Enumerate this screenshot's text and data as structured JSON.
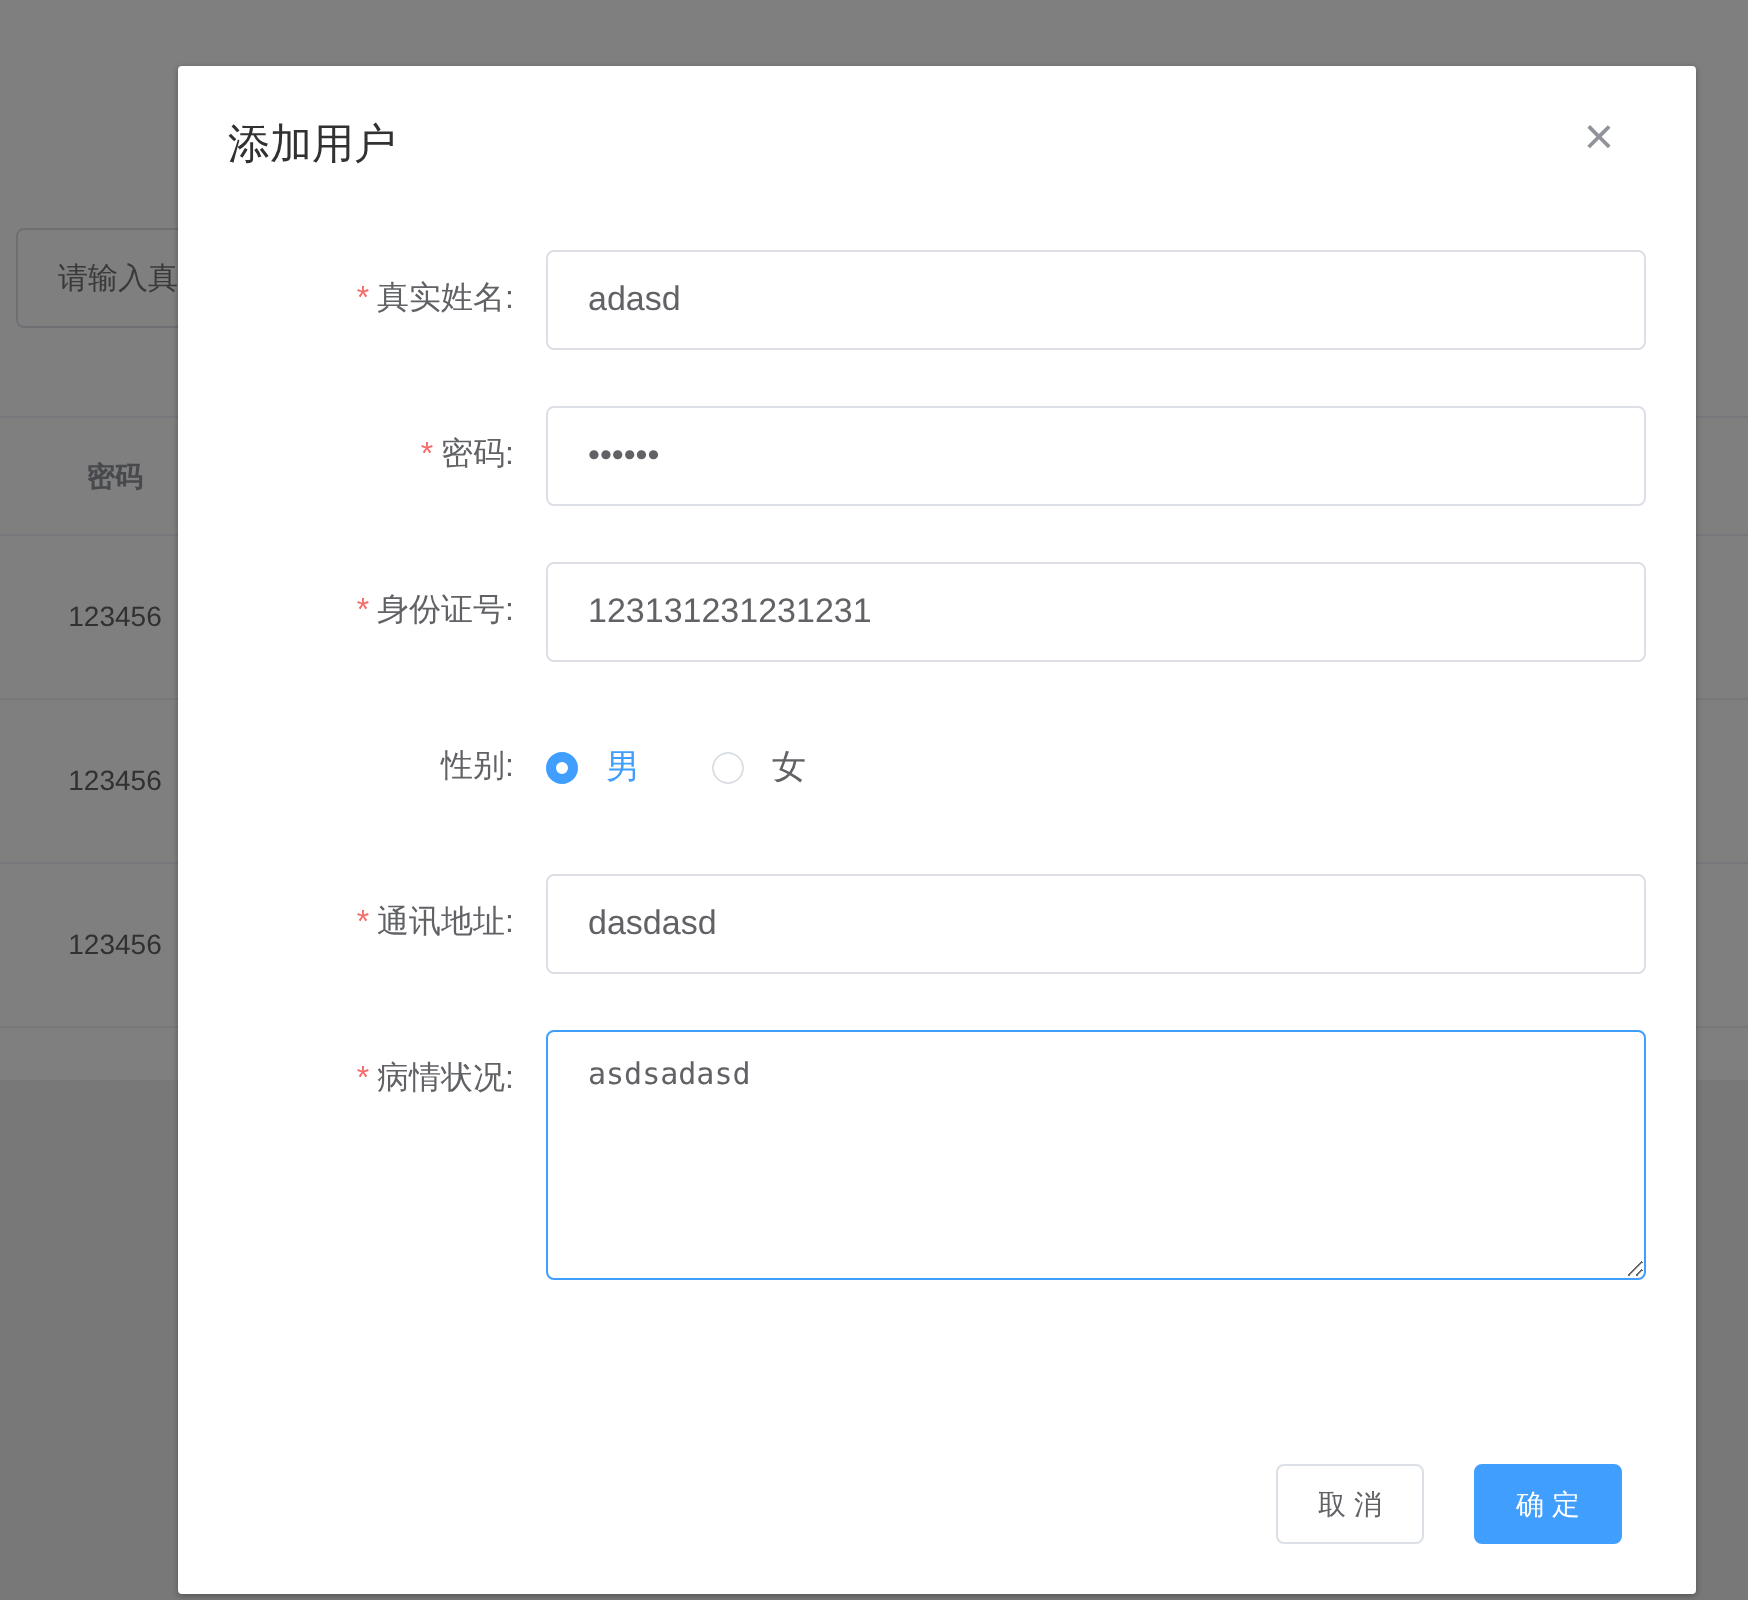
{
  "background": {
    "search": {
      "placeholder": "请输入真"
    },
    "table": {
      "columns": [
        "密码"
      ],
      "rows": [
        [
          "123456"
        ],
        [
          "123456"
        ],
        [
          "123456"
        ]
      ]
    }
  },
  "dialog": {
    "title": "添加用户",
    "close": "×",
    "required_mark": "*",
    "fields": [
      {
        "kind": "text",
        "label": "真实姓名:",
        "required": true,
        "value": "adasd",
        "focused": false
      },
      {
        "kind": "text",
        "label": "密码:",
        "required": true,
        "value": "••••••",
        "focused": false
      },
      {
        "kind": "text",
        "label": "身份证号:",
        "required": true,
        "value": "123131231231231",
        "focused": false
      },
      {
        "kind": "radio",
        "label": "性别:",
        "required": false,
        "options": [
          {
            "label": "男",
            "selected": true
          },
          {
            "label": "女",
            "selected": false
          }
        ]
      },
      {
        "kind": "text",
        "label": "通讯地址:",
        "required": true,
        "value": "dasdasd",
        "focused": false
      },
      {
        "kind": "textarea",
        "label": "病情状况:",
        "required": true,
        "value": "asdsadasd",
        "focused": true
      }
    ],
    "buttons": [
      {
        "label": "取 消",
        "kind": "default"
      },
      {
        "label": "确 定",
        "kind": "primary"
      }
    ]
  }
}
